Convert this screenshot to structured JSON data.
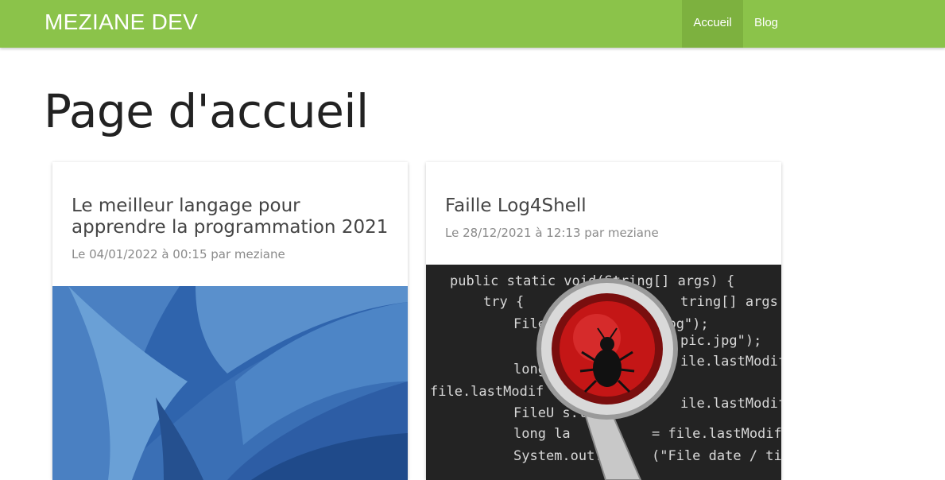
{
  "navbar": {
    "brand": "MEZIANE DEV",
    "items": [
      {
        "label": "Accueil",
        "active": true
      },
      {
        "label": "Blog",
        "active": false
      }
    ],
    "color": "#8bc34a"
  },
  "main": {
    "page_title": "Page d'accueil",
    "posts": [
      {
        "title": "Le meilleur langage pour apprendre la programmation 2021",
        "meta": "Le 04/01/2022 à 00:15 par meziane"
      },
      {
        "title": "Faille Log4Shell",
        "meta": "Le 28/12/2021 à 12:13 par meziane",
        "image_code": {
          "line1": "public static void(String[] args) {",
          "line2": "try {",
          "line3": "File = new Fi\"pic.jpg\");",
          "line4": "long as",
          "line5": "file.lastModif",
          "line6": "FileU s.touch",
          "line7": "long la",
          "line8": "System.out.pri",
          "right1": "tring[] args",
          "right2": "pic.jpg\");",
          "right3": "ile.lastModifie",
          "right4": "= file.lastModified",
          "right5": "(\"File date / tim",
          "right6": "ile.lastModif"
        }
      }
    ]
  }
}
